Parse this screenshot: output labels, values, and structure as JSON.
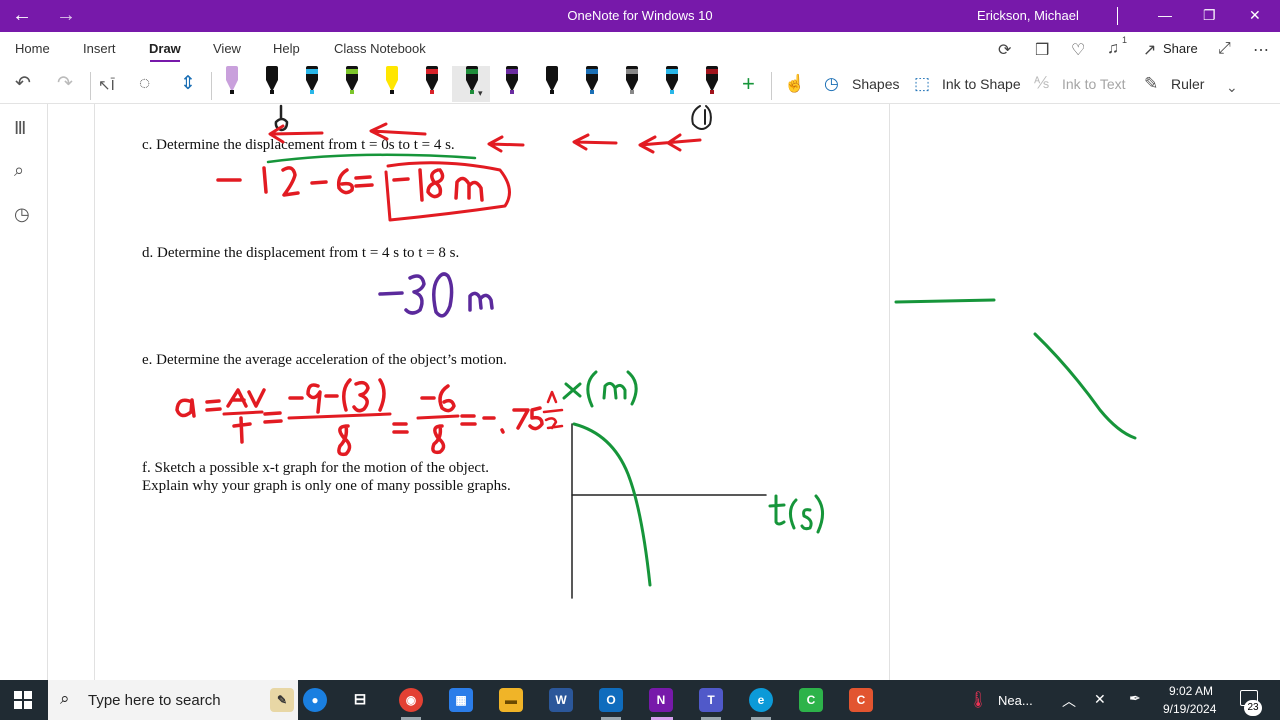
{
  "window": {
    "title": "OneNote for Windows 10",
    "user": "Erickson, Michael",
    "back_glyph": "←",
    "forward_glyph": "→",
    "minimize_glyph": "—",
    "restore_glyph": "❐",
    "close_glyph": "✕",
    "accent": "#7719aa"
  },
  "ribbon": {
    "tabs": [
      "Home",
      "Insert",
      "Draw",
      "View",
      "Help",
      "Class Notebook"
    ],
    "active_tab": "Draw",
    "share_label": "Share",
    "notification_count": "1"
  },
  "toolbar": {
    "shapes_label": "Shapes",
    "ink_to_shape_label": "Ink to Shape",
    "ink_to_text_label": "Ink to Text",
    "ruler_label": "Ruler",
    "pens": [
      {
        "color": "#c9a0dc",
        "type": "highlighter"
      },
      {
        "color": "#111111",
        "type": "pen"
      },
      {
        "color": "#29b6e8",
        "type": "pen"
      },
      {
        "color": "#7cc52b",
        "type": "pen"
      },
      {
        "color": "#ffe600",
        "type": "highlighter"
      },
      {
        "color": "#d8232a",
        "type": "pen"
      },
      {
        "color": "#1e8c3a",
        "type": "pen",
        "selected": true
      },
      {
        "color": "#6a2ca0",
        "type": "pen"
      },
      {
        "color": "#111111",
        "type": "pen"
      },
      {
        "color": "#1b6fb5",
        "type": "pen"
      },
      {
        "color": "#888888",
        "type": "pencil"
      },
      {
        "color": "#29b6e8",
        "type": "pen"
      },
      {
        "color": "#a0141c",
        "type": "pen"
      }
    ]
  },
  "page": {
    "questions": {
      "c": "c. Determine the displacement from t = 0s to t = 4 s.",
      "d": "d. Determine the displacement from t = 4 s to t = 8 s.",
      "e": "e. Determine the average acceleration of the object’s motion.",
      "f1": "f. Sketch a possible x-t graph for the motion of the object.",
      "f2": "Explain why your graph is only one of many possible graphs."
    },
    "ink_colors": {
      "red": "#e21b22",
      "green": "#16953a",
      "purple": "#5b2a9c",
      "black": "#222222"
    }
  },
  "taskbar": {
    "search_placeholder": "Type here to search",
    "weather_label": "Nea...",
    "time": "9:02 AM",
    "date": "9/19/2024",
    "notification_badge": "23"
  }
}
